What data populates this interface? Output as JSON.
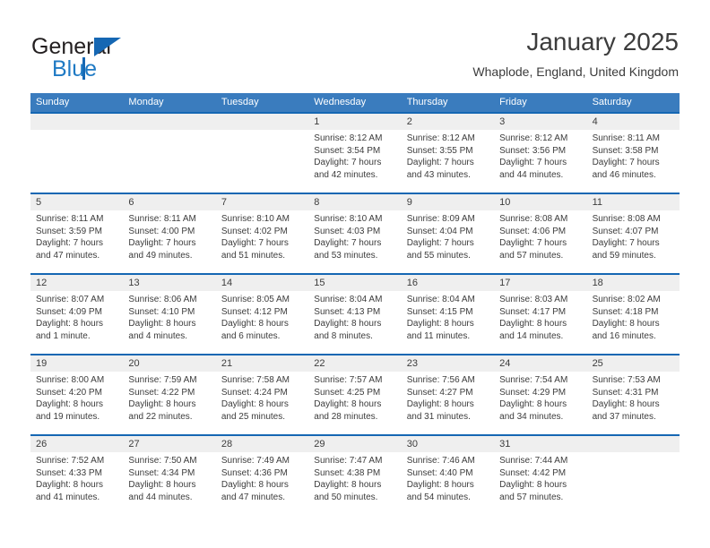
{
  "logo": {
    "word1": "General",
    "word2": "Blue",
    "triangle_color": "#1567b3",
    "blue_color": "#1f7ac4",
    "dark_color": "#231f20"
  },
  "header": {
    "title": "January 2025",
    "subtitle": "Whaplode, England, United Kingdom"
  },
  "theme": {
    "header_bar": "#3a7cbe",
    "row_rule": "#1567b3",
    "daynum_band": "#efefef",
    "text": "#3c3c3c"
  },
  "weekdays": [
    "Sunday",
    "Monday",
    "Tuesday",
    "Wednesday",
    "Thursday",
    "Friday",
    "Saturday"
  ],
  "weeks": [
    [
      {
        "day": "",
        "empty": true
      },
      {
        "day": "",
        "empty": true
      },
      {
        "day": "",
        "empty": true
      },
      {
        "day": "1",
        "sunrise": "Sunrise: 8:12 AM",
        "sunset": "Sunset: 3:54 PM",
        "daylight1": "Daylight: 7 hours",
        "daylight2": "and 42 minutes."
      },
      {
        "day": "2",
        "sunrise": "Sunrise: 8:12 AM",
        "sunset": "Sunset: 3:55 PM",
        "daylight1": "Daylight: 7 hours",
        "daylight2": "and 43 minutes."
      },
      {
        "day": "3",
        "sunrise": "Sunrise: 8:12 AM",
        "sunset": "Sunset: 3:56 PM",
        "daylight1": "Daylight: 7 hours",
        "daylight2": "and 44 minutes."
      },
      {
        "day": "4",
        "sunrise": "Sunrise: 8:11 AM",
        "sunset": "Sunset: 3:58 PM",
        "daylight1": "Daylight: 7 hours",
        "daylight2": "and 46 minutes."
      }
    ],
    [
      {
        "day": "5",
        "sunrise": "Sunrise: 8:11 AM",
        "sunset": "Sunset: 3:59 PM",
        "daylight1": "Daylight: 7 hours",
        "daylight2": "and 47 minutes."
      },
      {
        "day": "6",
        "sunrise": "Sunrise: 8:11 AM",
        "sunset": "Sunset: 4:00 PM",
        "daylight1": "Daylight: 7 hours",
        "daylight2": "and 49 minutes."
      },
      {
        "day": "7",
        "sunrise": "Sunrise: 8:10 AM",
        "sunset": "Sunset: 4:02 PM",
        "daylight1": "Daylight: 7 hours",
        "daylight2": "and 51 minutes."
      },
      {
        "day": "8",
        "sunrise": "Sunrise: 8:10 AM",
        "sunset": "Sunset: 4:03 PM",
        "daylight1": "Daylight: 7 hours",
        "daylight2": "and 53 minutes."
      },
      {
        "day": "9",
        "sunrise": "Sunrise: 8:09 AM",
        "sunset": "Sunset: 4:04 PM",
        "daylight1": "Daylight: 7 hours",
        "daylight2": "and 55 minutes."
      },
      {
        "day": "10",
        "sunrise": "Sunrise: 8:08 AM",
        "sunset": "Sunset: 4:06 PM",
        "daylight1": "Daylight: 7 hours",
        "daylight2": "and 57 minutes."
      },
      {
        "day": "11",
        "sunrise": "Sunrise: 8:08 AM",
        "sunset": "Sunset: 4:07 PM",
        "daylight1": "Daylight: 7 hours",
        "daylight2": "and 59 minutes."
      }
    ],
    [
      {
        "day": "12",
        "sunrise": "Sunrise: 8:07 AM",
        "sunset": "Sunset: 4:09 PM",
        "daylight1": "Daylight: 8 hours",
        "daylight2": "and 1 minute."
      },
      {
        "day": "13",
        "sunrise": "Sunrise: 8:06 AM",
        "sunset": "Sunset: 4:10 PM",
        "daylight1": "Daylight: 8 hours",
        "daylight2": "and 4 minutes."
      },
      {
        "day": "14",
        "sunrise": "Sunrise: 8:05 AM",
        "sunset": "Sunset: 4:12 PM",
        "daylight1": "Daylight: 8 hours",
        "daylight2": "and 6 minutes."
      },
      {
        "day": "15",
        "sunrise": "Sunrise: 8:04 AM",
        "sunset": "Sunset: 4:13 PM",
        "daylight1": "Daylight: 8 hours",
        "daylight2": "and 8 minutes."
      },
      {
        "day": "16",
        "sunrise": "Sunrise: 8:04 AM",
        "sunset": "Sunset: 4:15 PM",
        "daylight1": "Daylight: 8 hours",
        "daylight2": "and 11 minutes."
      },
      {
        "day": "17",
        "sunrise": "Sunrise: 8:03 AM",
        "sunset": "Sunset: 4:17 PM",
        "daylight1": "Daylight: 8 hours",
        "daylight2": "and 14 minutes."
      },
      {
        "day": "18",
        "sunrise": "Sunrise: 8:02 AM",
        "sunset": "Sunset: 4:18 PM",
        "daylight1": "Daylight: 8 hours",
        "daylight2": "and 16 minutes."
      }
    ],
    [
      {
        "day": "19",
        "sunrise": "Sunrise: 8:00 AM",
        "sunset": "Sunset: 4:20 PM",
        "daylight1": "Daylight: 8 hours",
        "daylight2": "and 19 minutes."
      },
      {
        "day": "20",
        "sunrise": "Sunrise: 7:59 AM",
        "sunset": "Sunset: 4:22 PM",
        "daylight1": "Daylight: 8 hours",
        "daylight2": "and 22 minutes."
      },
      {
        "day": "21",
        "sunrise": "Sunrise: 7:58 AM",
        "sunset": "Sunset: 4:24 PM",
        "daylight1": "Daylight: 8 hours",
        "daylight2": "and 25 minutes."
      },
      {
        "day": "22",
        "sunrise": "Sunrise: 7:57 AM",
        "sunset": "Sunset: 4:25 PM",
        "daylight1": "Daylight: 8 hours",
        "daylight2": "and 28 minutes."
      },
      {
        "day": "23",
        "sunrise": "Sunrise: 7:56 AM",
        "sunset": "Sunset: 4:27 PM",
        "daylight1": "Daylight: 8 hours",
        "daylight2": "and 31 minutes."
      },
      {
        "day": "24",
        "sunrise": "Sunrise: 7:54 AM",
        "sunset": "Sunset: 4:29 PM",
        "daylight1": "Daylight: 8 hours",
        "daylight2": "and 34 minutes."
      },
      {
        "day": "25",
        "sunrise": "Sunrise: 7:53 AM",
        "sunset": "Sunset: 4:31 PM",
        "daylight1": "Daylight: 8 hours",
        "daylight2": "and 37 minutes."
      }
    ],
    [
      {
        "day": "26",
        "sunrise": "Sunrise: 7:52 AM",
        "sunset": "Sunset: 4:33 PM",
        "daylight1": "Daylight: 8 hours",
        "daylight2": "and 41 minutes."
      },
      {
        "day": "27",
        "sunrise": "Sunrise: 7:50 AM",
        "sunset": "Sunset: 4:34 PM",
        "daylight1": "Daylight: 8 hours",
        "daylight2": "and 44 minutes."
      },
      {
        "day": "28",
        "sunrise": "Sunrise: 7:49 AM",
        "sunset": "Sunset: 4:36 PM",
        "daylight1": "Daylight: 8 hours",
        "daylight2": "and 47 minutes."
      },
      {
        "day": "29",
        "sunrise": "Sunrise: 7:47 AM",
        "sunset": "Sunset: 4:38 PM",
        "daylight1": "Daylight: 8 hours",
        "daylight2": "and 50 minutes."
      },
      {
        "day": "30",
        "sunrise": "Sunrise: 7:46 AM",
        "sunset": "Sunset: 4:40 PM",
        "daylight1": "Daylight: 8 hours",
        "daylight2": "and 54 minutes."
      },
      {
        "day": "31",
        "sunrise": "Sunrise: 7:44 AM",
        "sunset": "Sunset: 4:42 PM",
        "daylight1": "Daylight: 8 hours",
        "daylight2": "and 57 minutes."
      },
      {
        "day": "",
        "empty": true
      }
    ]
  ]
}
